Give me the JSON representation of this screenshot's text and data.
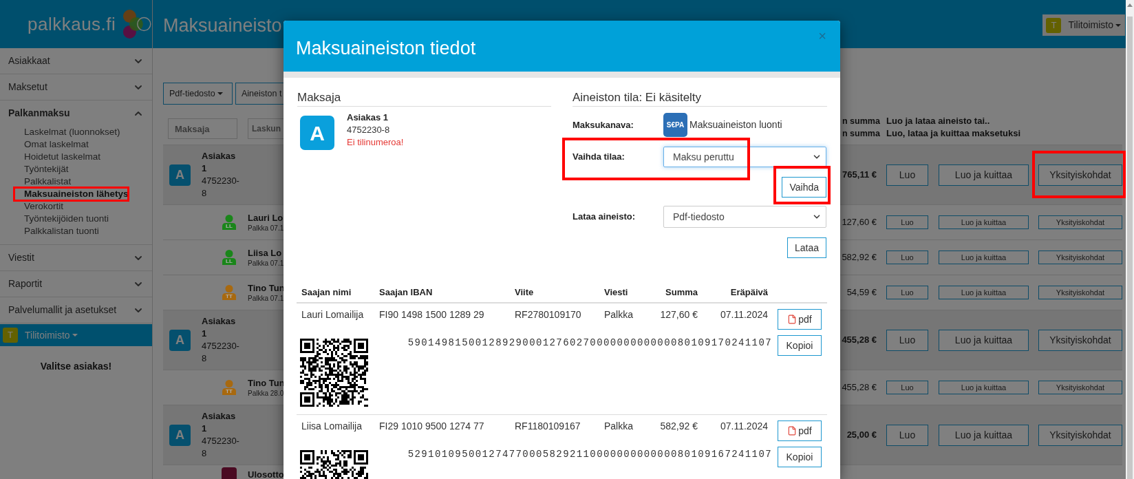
{
  "sidebar": {
    "logo": "palkkaus.fi",
    "sections": [
      {
        "label": "Asiakkaat",
        "expanded": false
      },
      {
        "label": "Maksetut",
        "expanded": false
      },
      {
        "label": "Palkanmaksu",
        "expanded": true,
        "children": [
          {
            "label": "Laskelmat (luonnokset)",
            "selected": false,
            "highlighted": false
          },
          {
            "label": "Omat laskelmat",
            "selected": false,
            "highlighted": false
          },
          {
            "label": "Hoidetut laskelmat",
            "selected": false,
            "highlighted": false
          },
          {
            "label": "Työntekijät",
            "selected": false,
            "highlighted": false
          },
          {
            "label": "Palkkalistat",
            "selected": false,
            "highlighted": false
          },
          {
            "label": "Maksuaineiston lähetys",
            "selected": true,
            "highlighted": true
          },
          {
            "label": "Verokortit",
            "selected": false,
            "highlighted": false
          },
          {
            "label": "Työntekijöiden tuonti",
            "selected": false,
            "highlighted": false
          },
          {
            "label": "Palkkalistan tuonti",
            "selected": false,
            "highlighted": false
          }
        ]
      },
      {
        "label": "Viestit",
        "expanded": false
      },
      {
        "label": "Raportit",
        "expanded": false
      },
      {
        "label": "Palvelumallit ja asetukset",
        "expanded": false
      }
    ],
    "account": {
      "badge": "T",
      "label": "Tilitoimisto"
    },
    "prompt": "Valitse asiakas!"
  },
  "header": {
    "title": "Maksuaineisto",
    "account": {
      "badge": "T",
      "label": "Tilitoimisto"
    }
  },
  "toolbar": [
    {
      "label": "Pdf-tiedosto",
      "dropdown": true
    },
    {
      "label": "Aineiston t"
    }
  ],
  "filters": [
    {
      "placeholder": "Maksaja"
    },
    {
      "placeholder": "Laskun"
    }
  ],
  "column_header": {
    "amount_lines": [
      "n summa",
      "n summa"
    ],
    "action_lines": [
      "Luo ja lataa aineisto tai..",
      "Luo, lataa ja kuittaa maksetuksi"
    ]
  },
  "rows": [
    {
      "kind": "customer",
      "avatar": "A",
      "name": "Asiakas 1",
      "id": "4752230-8",
      "amount": "765,11 €",
      "actions": [
        {
          "label": "Luo",
          "highlighted": false
        },
        {
          "label": "Luo ja kuittaa",
          "highlighted": false
        },
        {
          "label": "Yksityiskohdat",
          "highlighted": true
        }
      ]
    },
    {
      "kind": "employee",
      "initials": "LL",
      "color": "#1a861a",
      "name": "Lauri Lo",
      "detail": "Palkka 07.1",
      "amount": "127,60 €",
      "actions": [
        {
          "label": "Luo",
          "highlighted": false
        },
        {
          "label": "Luo ja kuittaa",
          "highlighted": false
        },
        {
          "label": "Yksityiskohdat",
          "highlighted": false
        }
      ]
    },
    {
      "kind": "employee",
      "initials": "LL",
      "color": "#1a861a",
      "name": "Liisa Lo",
      "detail": "Palkka 07.1",
      "amount": "582,92 €",
      "actions": [
        {
          "label": "Luo",
          "highlighted": false
        },
        {
          "label": "Luo ja kuittaa",
          "highlighted": false
        },
        {
          "label": "Yksityiskohdat",
          "highlighted": false
        }
      ]
    },
    {
      "kind": "employee",
      "initials": "TT",
      "color": "#a8690f",
      "name": "Tino Tun",
      "detail": "Palkka 07.1",
      "amount": "54,59 €",
      "actions": [
        {
          "label": "Luo",
          "highlighted": false
        },
        {
          "label": "Luo ja kuittaa",
          "highlighted": false
        },
        {
          "label": "Yksityiskohdat",
          "highlighted": false
        }
      ]
    },
    {
      "kind": "customer",
      "avatar": "A",
      "name": "Asiakas 1",
      "id": "4752230-8",
      "amount": "455,28 €",
      "actions": [
        {
          "label": "Luo",
          "highlighted": false
        },
        {
          "label": "Luo ja kuittaa",
          "highlighted": false
        },
        {
          "label": "Yksityiskohdat",
          "highlighted": false
        }
      ]
    },
    {
      "kind": "employee",
      "initials": "TT",
      "color": "#a8690f",
      "name": "Tino Tun",
      "detail": "Palkka 28.0",
      "amount": "455,28 €",
      "actions": [
        {
          "label": "Luo",
          "highlighted": false
        },
        {
          "label": "Luo ja kuittaa",
          "highlighted": false
        },
        {
          "label": "Yksityiskohdat",
          "highlighted": false
        }
      ]
    },
    {
      "kind": "customer",
      "avatar": "A",
      "name": "Asiakas 1",
      "id": "4752230-8",
      "amount": "25,00 €",
      "actions": [
        {
          "label": "Luo",
          "highlighted": false
        },
        {
          "label": "Luo ja kuittaa",
          "highlighted": false
        },
        {
          "label": "Yksityiskohdat",
          "highlighted": false
        }
      ]
    },
    {
      "kind": "deduction",
      "color": "#4a0a22",
      "name": "Ulosotto"
    }
  ],
  "modal": {
    "title": "Maksuaineiston tiedot",
    "close": "×",
    "payer": {
      "heading": "Maksaja",
      "avatar": "A",
      "name": "Asiakas 1",
      "id": "4752230-8",
      "warning": "Ei tilinumeroa!"
    },
    "status": {
      "heading": "Aineiston tila: Ei käsitelty",
      "channel_label": "Maksukanava:",
      "channel_logo": "S€PA",
      "channel_value": "Maksuaineiston luonti",
      "change_label": "Vaihda tilaa:",
      "change_value": "Maksu peruttu",
      "change_highlighted": true,
      "change_button": "Vaihda",
      "change_button_highlighted": true,
      "download_label": "Lataa aineisto:",
      "download_value": "Pdf-tiedosto",
      "download_button": "Lataa"
    },
    "payments": {
      "columns": [
        "Saajan nimi",
        "Saajan IBAN",
        "Viite",
        "Viesti",
        "Summa",
        "Eräpäivä"
      ],
      "rows": [
        {
          "name": "Lauri Lomailija",
          "iban": "FI90 1498 1500 1289 29",
          "reference": "RF2780109170",
          "message": "Palkka",
          "amount": "127,60 €",
          "due": "07.11.2024",
          "pdf": "pdf",
          "barcode": "590149815001289290001276027000000000000080109170241107",
          "copy": "Kopioi"
        },
        {
          "name": "Liisa Lomailija",
          "iban": "FI29 1010 9500 1274 77",
          "reference": "RF1180109167",
          "message": "Palkka",
          "amount": "582,92 €",
          "due": "07.11.2024",
          "pdf": "pdf",
          "barcode": "529101095001274770005829211000000000000080109167241107",
          "copy": "Kopioi"
        }
      ]
    }
  }
}
